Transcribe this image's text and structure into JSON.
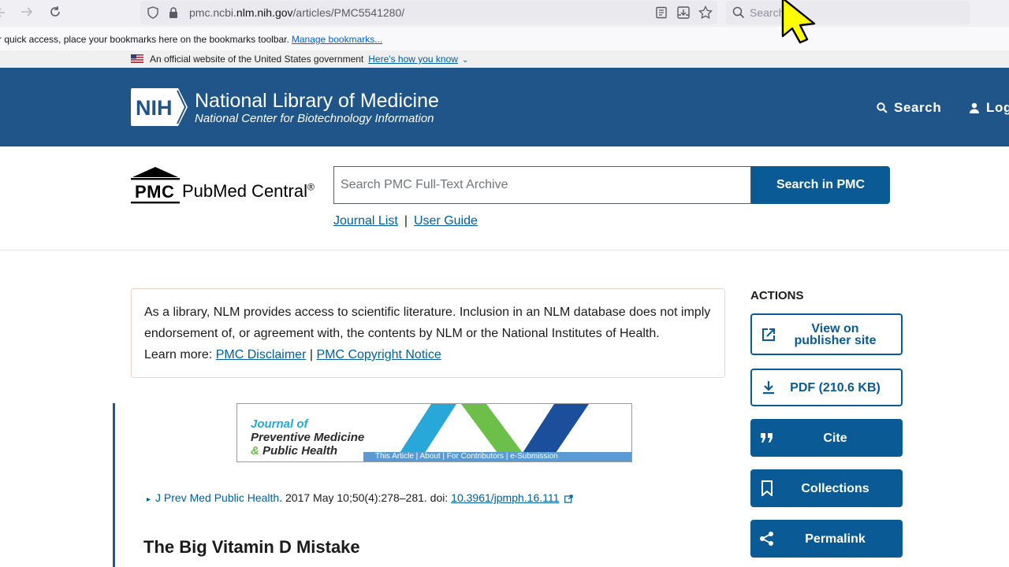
{
  "browser": {
    "url_prefix": "pmc.ncbi.",
    "url_host": "nlm.nih.gov",
    "url_path": "/articles/PMC5541280/",
    "search_placeholder": "Search",
    "bookmarks_text": "r quick access, place your bookmarks here on the bookmarks toolbar.",
    "bookmarks_link": "Manage bookmarks..."
  },
  "gov_banner": {
    "text": "An official website of the United States government",
    "link": "Here's how you know"
  },
  "nih_header": {
    "badge": "NIH",
    "title": "National Library of Medicine",
    "subtitle": "National Center for Biotechnology Information",
    "search_label": "Search",
    "login_label": "Log"
  },
  "pmc_header": {
    "logo_word": "PMC",
    "logo_text": "PubMed Central",
    "logo_mark": "®",
    "search_placeholder": "Search PMC Full-Text Archive",
    "search_button": "Search in PMC",
    "links": [
      "Journal List",
      "User Guide"
    ],
    "link_separator": "|"
  },
  "disclaimer": {
    "text": "As a library, NLM provides access to scientific literature. Inclusion in an NLM database does not imply endorsement of, or agreement with, the contents by NLM or the National Institutes of Health.",
    "learn_more": "Learn more:",
    "link1": "PMC Disclaimer",
    "separator": "|",
    "link2": "PMC Copyright Notice"
  },
  "journal_banner": {
    "line1": "Journal of",
    "line2": "Preventive Medicine",
    "line3_amp": "&",
    "line3_rest": "Public Health",
    "nav": "This Article  |  About  |  For Contributors  |  e-Submission"
  },
  "citation": {
    "bullet": "▸",
    "journal": "J Prev Med Public Health",
    "details": ". 2017 May 10;50(4):278–281. doi: ",
    "doi": "10.3961/jpmph.16.111"
  },
  "article": {
    "title": "The Big Vitamin D Mistake"
  },
  "actions": {
    "heading": "ACTIONS",
    "view_publisher_line1": "View on",
    "view_publisher_line2": "publisher site",
    "pdf": "PDF (210.6 KB)",
    "cite": "Cite",
    "collections": "Collections",
    "permalink": "Permalink"
  },
  "icons": {
    "back": "back-arrow-icon",
    "forward": "forward-arrow-icon",
    "reload": "reload-icon",
    "shield": "shield-icon",
    "lock": "lock-icon",
    "reader": "reader-view-icon",
    "save": "save-to-pocket-icon",
    "bookmark_star": "star-icon",
    "search": "search-icon",
    "flag": "us-flag-icon",
    "cursor": "mouse-cursor-icon"
  },
  "colors": {
    "nih_blue": "#20558a",
    "button_blue": "#0a5a96",
    "link_blue": "#005ea2",
    "disclaimer_border": "#f2d4c4"
  }
}
